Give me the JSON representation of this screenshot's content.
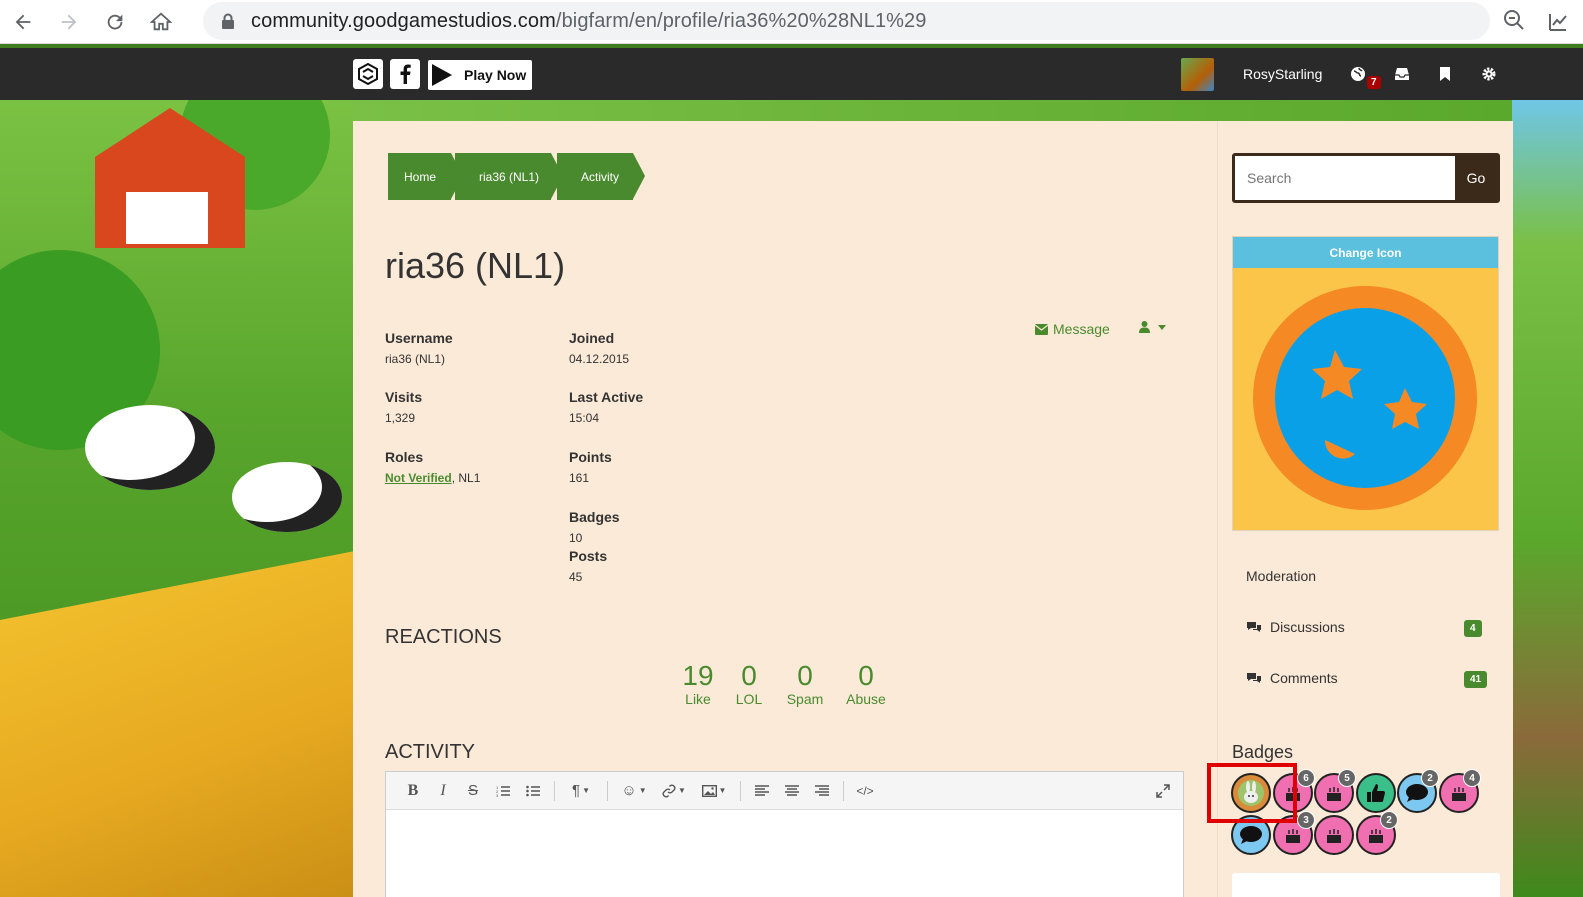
{
  "browser": {
    "url_host": "community.goodgamestudios.com",
    "url_path": "/bigfarm/en/profile/ria36%20%28NL1%29"
  },
  "header": {
    "play_now": "Play Now",
    "username": "RosyStarling",
    "notification_count": "7"
  },
  "breadcrumb": [
    {
      "label": "Home"
    },
    {
      "label": "ria36 (NL1)"
    },
    {
      "label": "Activity"
    }
  ],
  "profile": {
    "title": "ria36 (NL1)",
    "message_label": "Message",
    "fields": {
      "username_label": "Username",
      "username_value": "ria36 (NL1)",
      "joined_label": "Joined",
      "joined_value": "04.12.2015",
      "visits_label": "Visits",
      "visits_value": "1,329",
      "last_active_label": "Last Active",
      "last_active_value": "15:04",
      "roles_label": "Roles",
      "roles_link": "Not Verified",
      "roles_rest": ", NL1",
      "points_label": "Points",
      "points_value": "161",
      "badges_label": "Badges",
      "badges_value": "10",
      "posts_label": "Posts",
      "posts_value": "45"
    }
  },
  "reactions": {
    "heading": "REACTIONS",
    "items": [
      {
        "count": "19",
        "label": "Like"
      },
      {
        "count": "0",
        "label": "LOL"
      },
      {
        "count": "0",
        "label": "Spam"
      },
      {
        "count": "0",
        "label": "Abuse"
      }
    ]
  },
  "activity": {
    "heading": "ACTIVITY",
    "toolbar": [
      "bold-icon",
      "italic-icon",
      "strikethrough-icon",
      "ordered-list-icon",
      "bullet-list-icon",
      "paragraph-icon",
      "emoji-icon",
      "link-icon",
      "image-icon",
      "align-left-icon",
      "align-center-icon",
      "align-right-icon",
      "code-icon",
      "fullscreen-icon"
    ]
  },
  "sidebar": {
    "search_placeholder": "Search",
    "search_go": "Go",
    "change_icon": "Change Icon",
    "moderation": "Moderation",
    "discussions_label": "Discussions",
    "discussions_count": "4",
    "comments_label": "Comments",
    "comments_count": "41",
    "badges_heading": "Badges",
    "badges": [
      {
        "icon": "rabbit-badge-icon",
        "count": ""
      },
      {
        "icon": "cake-badge-icon",
        "count": "6"
      },
      {
        "icon": "cake-badge-icon",
        "count": "5"
      },
      {
        "icon": "thumbs-up-badge-icon",
        "count": ""
      },
      {
        "icon": "comment-badge-icon",
        "count": "2"
      },
      {
        "icon": "cake-badge-icon",
        "count": "4"
      },
      {
        "icon": "comment-badge-icon",
        "count": ""
      },
      {
        "icon": "cake-badge-icon",
        "count": "3"
      },
      {
        "icon": "cake-badge-icon",
        "count": ""
      },
      {
        "icon": "cake-badge-icon",
        "count": "2"
      }
    ]
  },
  "colors": {
    "accent_green": "#4a8a2e",
    "panel_bg": "#fbead8",
    "header_bg": "#2a2a2a",
    "highlight_red": "#e00000"
  }
}
